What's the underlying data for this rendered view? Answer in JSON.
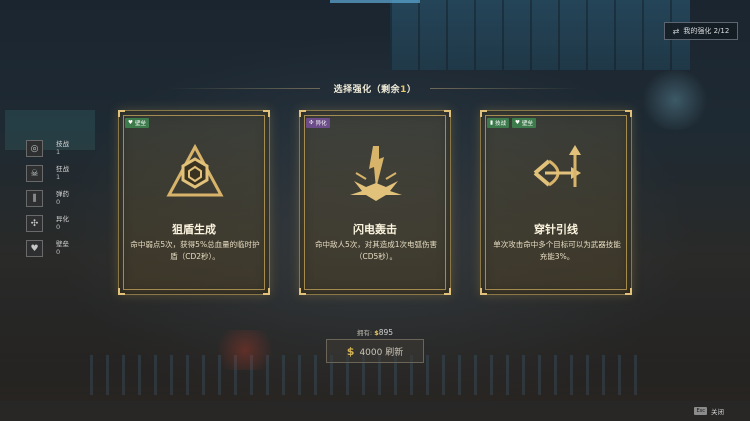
{
  "top_bar": {
    "my_upgrades_label": "我的强化 2/12"
  },
  "header": {
    "title_prefix": "选择强化（剩余",
    "remaining": "1",
    "title_suffix": "）"
  },
  "stats": [
    {
      "label": "技战",
      "value": "1",
      "icon": "target-icon"
    },
    {
      "label": "狂战",
      "value": "1",
      "icon": "skull-icon"
    },
    {
      "label": "弹药",
      "value": "0",
      "icon": "ammo-icon"
    },
    {
      "label": "异化",
      "value": "0",
      "icon": "mutation-icon"
    },
    {
      "label": "壁垒",
      "value": "0",
      "icon": "heart-shield-icon"
    }
  ],
  "cards": [
    {
      "tags": [
        "壁垒"
      ],
      "title": "狙盾生成",
      "desc": "命中弱点5次，获得5%总血量的临时护盾（CD2秒）。",
      "icon": "hex-shield-icon"
    },
    {
      "tags": [
        "异化"
      ],
      "title": "闪电轰击",
      "desc": "命中敌人5次，对其造成1次电弧伤害（CD5秒）。",
      "icon": "lightning-strike-icon"
    },
    {
      "tags": [
        "技战",
        "壁垒"
      ],
      "title": "穿针引线",
      "desc": "单次攻击命中多个目标可以为武器技能充能3%。",
      "icon": "bow-arrow-icon"
    }
  ],
  "currency": {
    "owned_label": "拥有:",
    "coin_symbol": "$",
    "owned_amount": "895"
  },
  "refresh": {
    "coin_symbol": "$",
    "label": "4000 刷新"
  },
  "bottom": {
    "key_label": "Esc",
    "close_label": "关闭"
  },
  "colors": {
    "accent_gold": "#e9c86b",
    "tag_green": "#3d7a4c",
    "tag_purple": "#6c4d89",
    "card_border": "#8a7748"
  }
}
